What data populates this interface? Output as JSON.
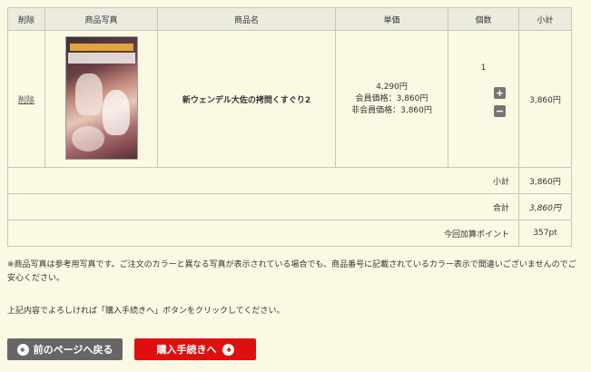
{
  "headers": {
    "delete": "削除",
    "photo": "商品写真",
    "name": "商品名",
    "unit_price": "単価",
    "quantity": "個数",
    "subtotal": "小計"
  },
  "item": {
    "delete_link": "削除",
    "name": "新ウェンデル大佐の拷問くすぐり2",
    "price": "4,290円",
    "member_price": "会員価格：3,860円",
    "nonmember_price": "非会員価格：3,860円",
    "quantity": "1",
    "plus_label": "+",
    "minus_label": "−",
    "subtotal": "3,860円"
  },
  "summary": {
    "subtotal_label": "小計",
    "subtotal_value": "3,860円",
    "total_label": "合計",
    "total_value": "3,860円",
    "points_label": "今回加算ポイント",
    "points_value": "357pt"
  },
  "note": "※商品写真は参考用写真です。ご注文のカラーと異なる写真が表示されている場合でも、商品番号に記載されているカラー表示で間違いございませんのでご安心ください。",
  "instruction": "上記内容でよろしければ「購入手続きへ」ボタンをクリックしてください。",
  "buttons": {
    "back": "前のページへ戻る",
    "purchase": "購入手続きへ"
  },
  "colors": {
    "background": "#fbf9e3",
    "header_bg": "#ecebdf",
    "back_button": "#666666",
    "purchase_button": "#e00f0f"
  }
}
